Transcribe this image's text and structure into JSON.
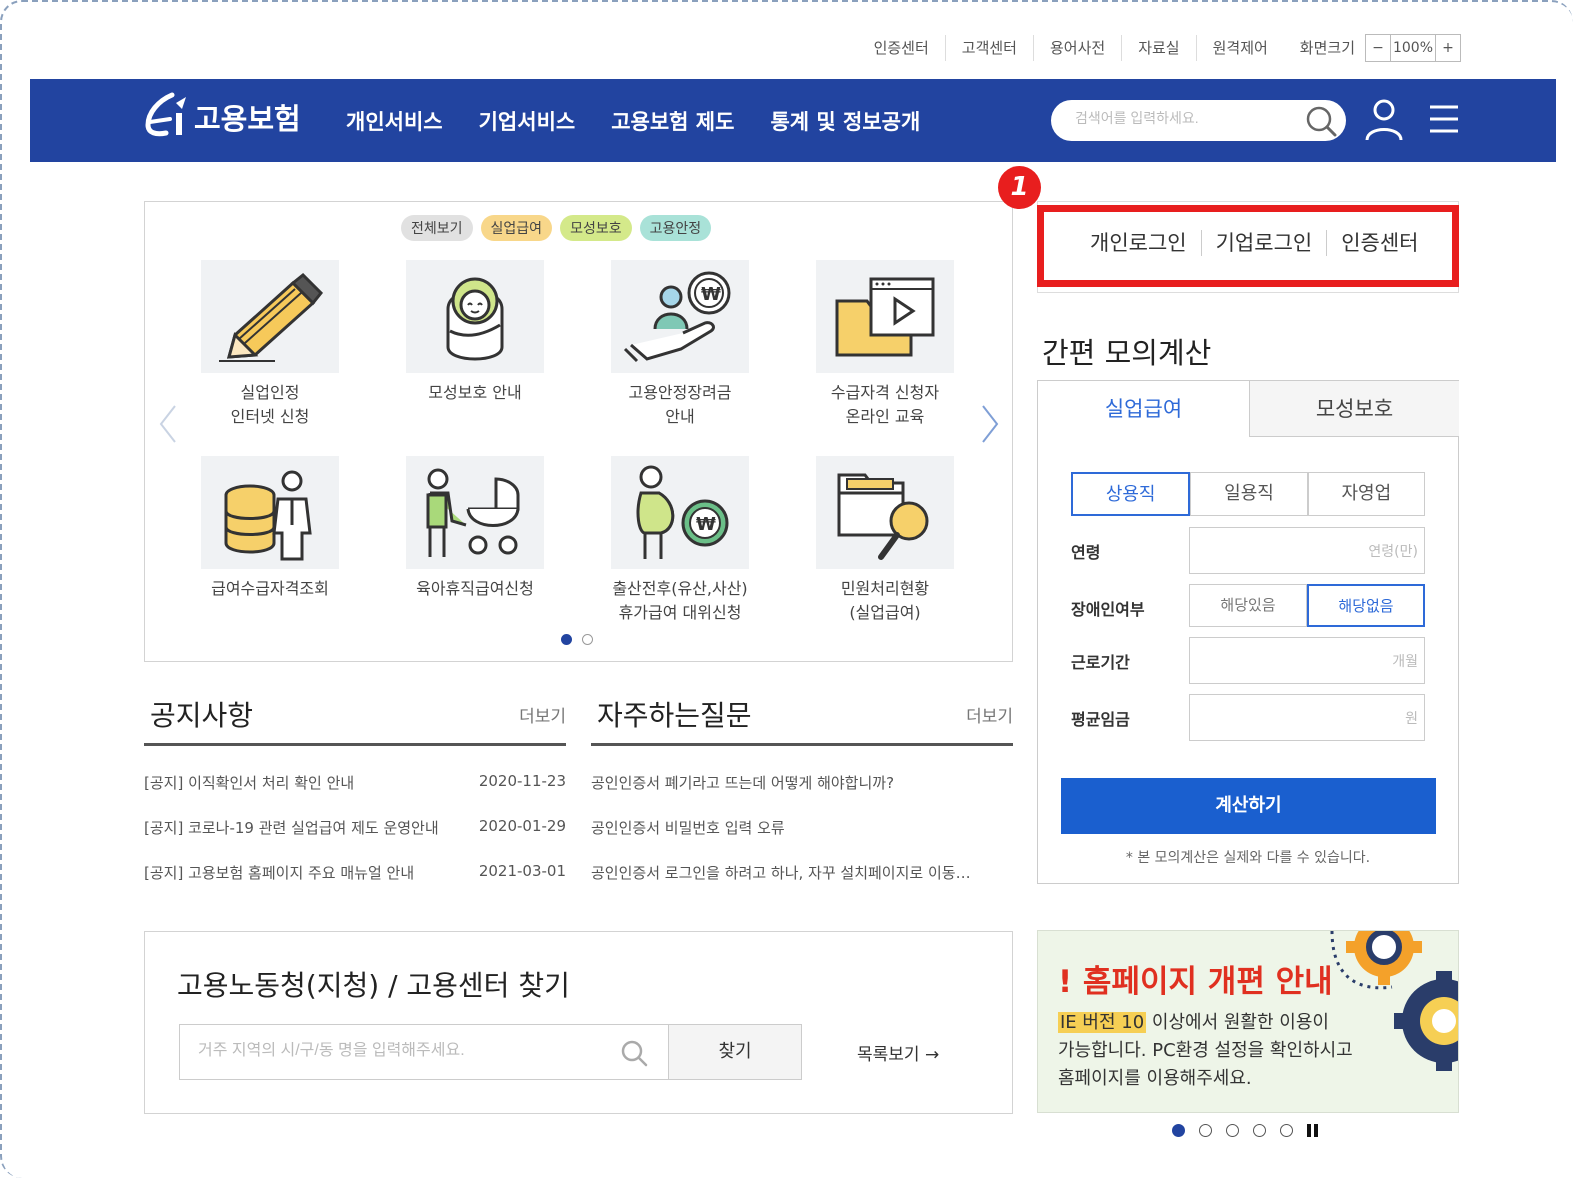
{
  "util_links": [
    "인증센터",
    "고객센터",
    "용어사전",
    "자료실",
    "원격제어",
    "화면크기"
  ],
  "zoom": {
    "minus": "−",
    "value": "100%",
    "plus": "+"
  },
  "gnb": {
    "logo_text": "고용보험",
    "menu": [
      "개인서비스",
      "기업서비스",
      "고용보험 제도",
      "통계 및 정보공개"
    ],
    "search_placeholder": "검색어를 입력하세요."
  },
  "quick": {
    "chips": [
      {
        "label": "전체보기",
        "color": "#e1e1e1"
      },
      {
        "label": "실업급여",
        "color": "#f8d78a"
      },
      {
        "label": "모성보호",
        "color": "#d4e98a"
      },
      {
        "label": "고용안정",
        "color": "#a9e2d8"
      }
    ],
    "tiles": [
      {
        "label": "실업인정\n인터넷 신청",
        "icon": "pencil-icon"
      },
      {
        "label": "모성보호 안내",
        "icon": "baby-icon"
      },
      {
        "label": "고용안정장려금\n안내",
        "icon": "hand-coin-icon"
      },
      {
        "label": "수급자격 신청자\n온라인 교육",
        "icon": "video-folder-icon"
      },
      {
        "label": "급여수급자격조회",
        "icon": "coins-person-icon"
      },
      {
        "label": "육아휴직급여신청",
        "icon": "stroller-icon"
      },
      {
        "label": "출산전후(유산,사산)\n휴가급여 대위신청",
        "icon": "pregnant-coin-icon"
      },
      {
        "label": "민원처리현황\n(실업급여)",
        "icon": "folder-search-icon"
      }
    ]
  },
  "login": {
    "links": [
      "개인로그인",
      "기업로그인",
      "인증센터"
    ],
    "badge": "1"
  },
  "calc": {
    "title": "간편 모의계산",
    "tabs": [
      "실업급여",
      "모성보호"
    ],
    "types": [
      "상용직",
      "일용직",
      "자영업"
    ],
    "fields": {
      "age_label": "연령",
      "age_placeholder": "연령(만)",
      "disability_label": "장애인여부",
      "disability_yes": "해당있음",
      "disability_no": "해당없음",
      "period_label": "근로기간",
      "period_placeholder": "개월",
      "wage_label": "평균임금",
      "wage_placeholder": "원"
    },
    "button": "계산하기",
    "note": "* 본 모의계산은 실제와 다를 수 있습니다."
  },
  "notice": {
    "title": "공지사항",
    "more": "더보기",
    "items": [
      {
        "title": "[공지] 이직확인서 처리 확인 안내",
        "date": "2020-11-23"
      },
      {
        "title": "[공지] 코로나-19 관련 실업급여 제도 운영안내",
        "date": "2020-01-29"
      },
      {
        "title": "[공지] 고용보험 홈페이지 주요 매뉴얼 안내",
        "date": "2021-03-01"
      }
    ]
  },
  "faq": {
    "title": "자주하는질문",
    "more": "더보기",
    "items": [
      "공인인증서 폐기라고 뜨는데 어떻게 해야합니까?",
      "공인인증서 비밀번호 입력 오류",
      "공인인증서 로그인을 하려고 하나, 자꾸 설치페이지로 이동…"
    ]
  },
  "finder": {
    "title": "고용노동청(지청) / 고용센터 찾기",
    "placeholder": "거주 지역의 시/구/동 명을 입력해주세요.",
    "button": "찾기",
    "list_link": "목록보기 →"
  },
  "banner": {
    "title": "! 홈페이지 개편 안내",
    "highlight": "IE 버전 10",
    "text": "이상에서 원활한 이용이\n가능합니다. PC환경 설정을 확인하시고\n홈페이지를 이용해주세요."
  }
}
